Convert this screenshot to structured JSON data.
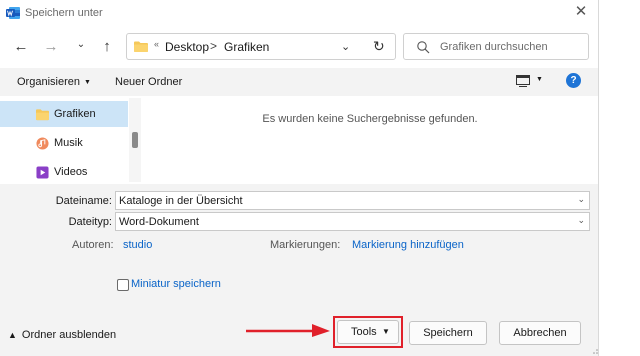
{
  "window": {
    "title": "Speichern unter"
  },
  "nav": {
    "back": "←",
    "forward": "→",
    "up_chev": "⌄",
    "up": "↑",
    "breadcrumb": [
      "Desktop",
      "Grafiken"
    ],
    "breadcrumb_sep": ">",
    "overflow": "«",
    "refresh": "↻"
  },
  "search": {
    "placeholder": "Grafiken durchsuchen"
  },
  "toolbar": {
    "organize_label": "Organisieren",
    "new_folder_label": "Neuer Ordner",
    "help": "?"
  },
  "sidebar": {
    "items": [
      {
        "label": "Grafiken",
        "icon": "folder-icon",
        "selected": true
      },
      {
        "label": "Musik",
        "icon": "music-icon",
        "selected": false
      },
      {
        "label": "Videos",
        "icon": "video-icon",
        "selected": false
      }
    ]
  },
  "content": {
    "empty_message": "Es wurden keine Suchergebnisse gefunden."
  },
  "form": {
    "filename_label": "Dateiname:",
    "filename_value": "Kataloge in der Übersicht",
    "filetype_label": "Dateityp:",
    "filetype_value": "Word-Dokument",
    "authors_label": "Autoren:",
    "authors_value": "studio",
    "tags_label": "Markierungen:",
    "tags_value": "Markierung hinzufügen",
    "thumbnail_label": "Miniatur speichern"
  },
  "footer": {
    "hide_folders_label": "Ordner ausblenden",
    "tools_label": "Tools",
    "save_label": "Speichern",
    "cancel_label": "Abbrechen"
  },
  "colors": {
    "accent": "#1e74d6",
    "link": "#0a64c8",
    "highlight": "#e0202a",
    "selected": "#cce4f7"
  }
}
